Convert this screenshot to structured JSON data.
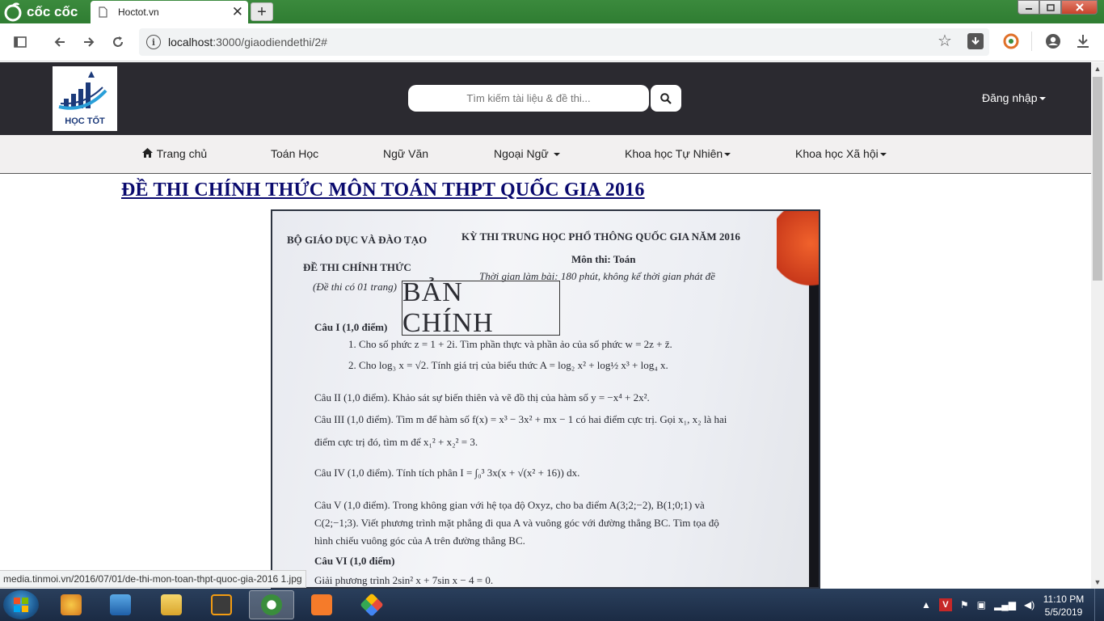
{
  "browser": {
    "brand_name": "cốc cốc",
    "tab_title": "Hoctot.vn",
    "tab_close": "✕",
    "new_tab": "+",
    "url_host": "localhost",
    "url_path": ":3000/giaodiendethi/2#",
    "status_url": "media.tinmoi.vn/2016/07/01/de-thi-mon-toan-thpt-quoc-gia-2016 1.jpg"
  },
  "site": {
    "logo_text": "HỌC TỐT",
    "search_placeholder": "Tìm kiếm tài liệu & đề thi...",
    "login_label": "Đăng nhập",
    "menu": [
      {
        "label": "Trang chủ"
      },
      {
        "label": "Toán Học"
      },
      {
        "label": "Ngữ Văn"
      },
      {
        "label": "Ngoại Ngữ"
      },
      {
        "label": "Khoa học Tự Nhiên"
      },
      {
        "label": "Khoa học Xã hội"
      }
    ]
  },
  "content": {
    "title": "ĐỀ THI CHÍNH THỨC MÔN TOÁN THPT QUỐC GIA 2016",
    "exam": {
      "ministry": "BỘ GIÁO DỤC VÀ ĐÀO TẠO",
      "exam_name": "KỲ THI TRUNG HỌC PHỔ THÔNG QUỐC GIA NĂM 2016",
      "official": "ĐỀ THI CHÍNH THỨC",
      "pages": "(Đề thi có 01 trang)",
      "subject": "Môn thi: Toán",
      "time": "Thời gian làm bài: 180 phút, không kể thời gian phát đề",
      "stamp": "BẢN CHÍNH",
      "q1_head": "Câu I (1,0 điểm)",
      "q1_1": "1. Cho số phức  z = 1 + 2i.  Tìm phần thực và phần ảo của số phức  w = 2z + z̄.",
      "q1_2": "2. Cho  log₃ x = √2.  Tính giá trị của biểu thức  A = log₂ x² + log½ x³ + log₄ x.",
      "q2": "Câu II (1,0 điểm). Khảo sát sự biến thiên và vẽ đồ thị của hàm số  y = −x⁴ + 2x².",
      "q3a": "Câu III (1,0 điểm). Tìm m để hàm số  f(x) = x³ − 3x² + mx − 1  có hai điểm cực trị. Gọi  x₁, x₂  là hai",
      "q3b": "điểm cực trị đó, tìm m để  x₁² + x₂² = 3.",
      "q4": "Câu IV (1,0 điểm). Tính tích phân  I = ∫₀³ 3x(x + √(x² + 16)) dx.",
      "q5a": "Câu V (1,0 điểm). Trong không gian với hệ tọa độ Oxyz, cho ba điểm A(3;2;−2), B(1;0;1) và",
      "q5b": "C(2;−1;3). Viết phương trình mặt phẳng đi qua A và vuông góc với đường thẳng BC. Tìm tọa độ",
      "q5c": "hình chiếu vuông góc của A trên đường thẳng BC.",
      "q6_head": "Câu VI (1,0 điểm)",
      "q6_1": "Giải phương trình  2sin² x + 7sin x − 4 = 0."
    }
  },
  "taskbar": {
    "time": "11:10 PM",
    "date": "5/5/2019"
  }
}
